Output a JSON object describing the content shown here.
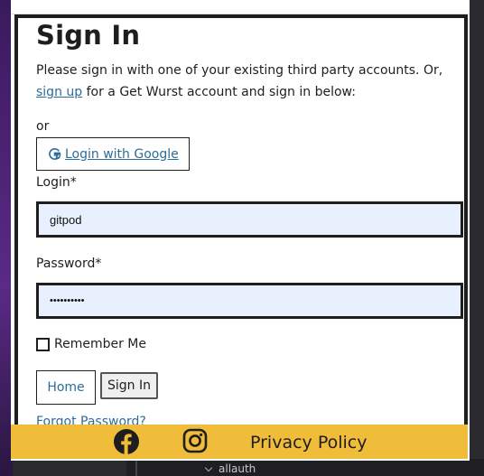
{
  "background": {
    "tree_item": "allauth"
  },
  "signin": {
    "title": "Sign In",
    "intro_before": "Please sign in with one of your existing third party accounts. Or, ",
    "signup_link": "sign up",
    "intro_after": " for a Get Wurst account and sign in below:",
    "or_text": "or",
    "google_button_label": "Login with Google",
    "login_label": "Login*",
    "login_value": "gitpod",
    "password_label": "Password*",
    "password_value": "••••••••••",
    "remember_label": "Remember Me",
    "home_button": "Home",
    "signin_button": "Sign In",
    "forgot_link": "Forgot Password?"
  },
  "footer": {
    "privacy_label": "Privacy Policy",
    "facebook_icon": "facebook-icon",
    "instagram_icon": "instagram-icon"
  },
  "colors": {
    "footer_bg": "#f0bd3a",
    "link": "#2c6d98",
    "input_bg": "#e8f0fe",
    "border": "#1e1e1e"
  }
}
